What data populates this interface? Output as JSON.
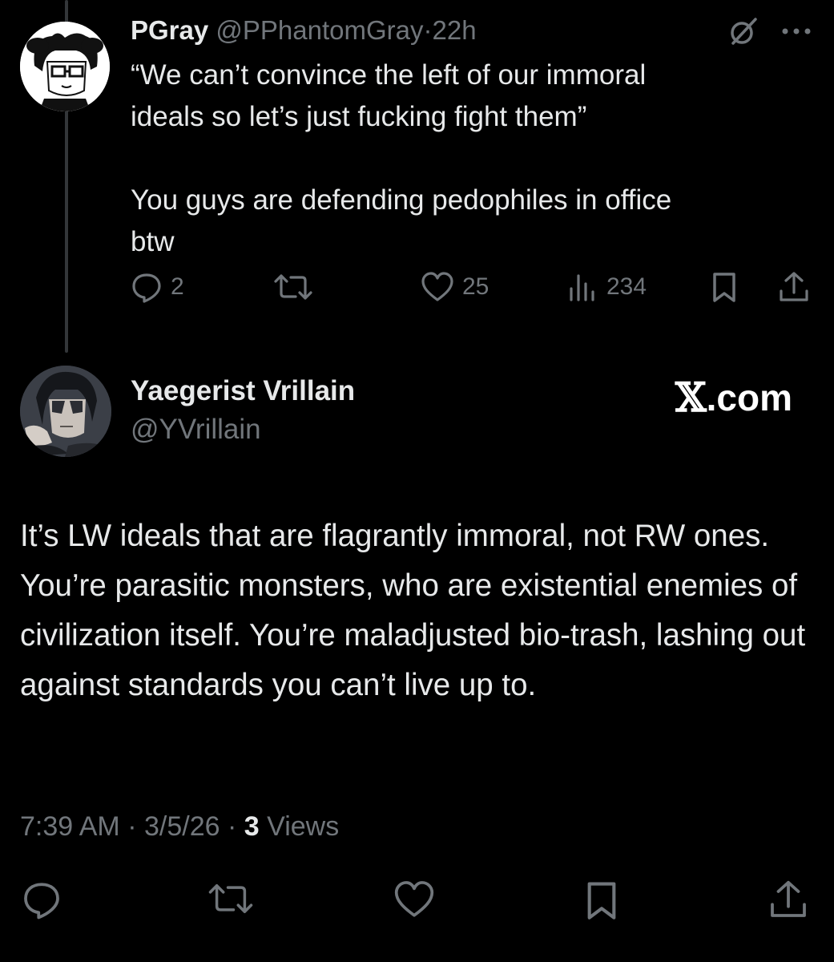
{
  "parent_tweet": {
    "display_name": "PGray",
    "handle": "@PPhantomGray",
    "separator": "·",
    "time_ago": "22h",
    "text_paragraphs": [
      "“We can’t convince the left of our immoral\nideals so let’s just fucking fight them”",
      "You guys are defending pedophiles in office\nbtw"
    ],
    "replies": "2",
    "retweets": "",
    "likes": "25",
    "views": "234",
    "icons": [
      "grok-icon",
      "more-icon",
      "reply-icon",
      "retweet-icon",
      "like-icon",
      "views-icon",
      "bookmark-icon",
      "share-icon"
    ]
  },
  "main_tweet": {
    "display_name": "Yaegerist Vrillain",
    "handle": "@YVrillain",
    "brand": {
      "x": "𝕏",
      "suffix": ".com"
    },
    "text": "It’s LW ideals that are flagrantly immoral, not RW ones. You’re parasitic monsters, who are existential enemies of civilization itself. You’re maladjusted bio-trash, lashing out against standards you can’t live up to.",
    "time": "7:39 AM",
    "sep": "·",
    "date": "3/5/26",
    "views_count": "3",
    "views_label": "Views",
    "icons": [
      "reply-icon",
      "retweet-icon",
      "like-icon",
      "bookmark-icon",
      "share-icon"
    ]
  },
  "colors": {
    "background": "#000000",
    "text": "#e7e9ea",
    "muted": "#71767b",
    "thread_line": "#333639"
  }
}
